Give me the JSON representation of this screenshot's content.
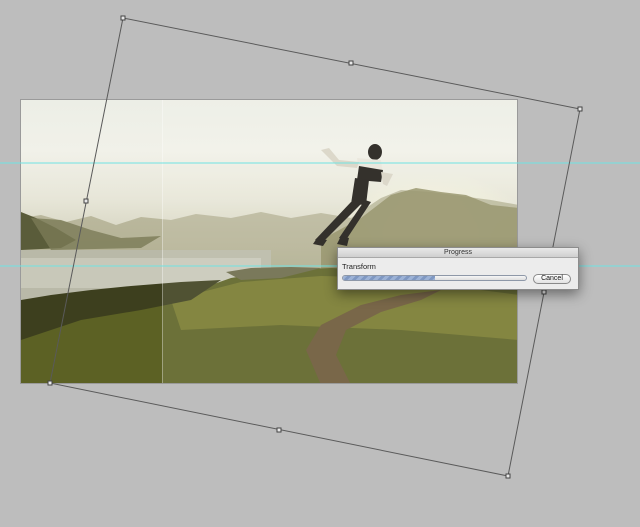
{
  "progress_dialog": {
    "title": "Progress",
    "operation": "Transform",
    "progress_fraction": 0.5,
    "cancel_label": "Cancel"
  },
  "colors": {
    "canvas_background": "#bdbdbd",
    "guide_line": "#6fe3e3",
    "bounding_box": "#5a5a5a",
    "progress_fill": "#8aa3cc"
  },
  "icons": {
    "transform_handle": "square-handle",
    "rotation_center": "center-point"
  }
}
